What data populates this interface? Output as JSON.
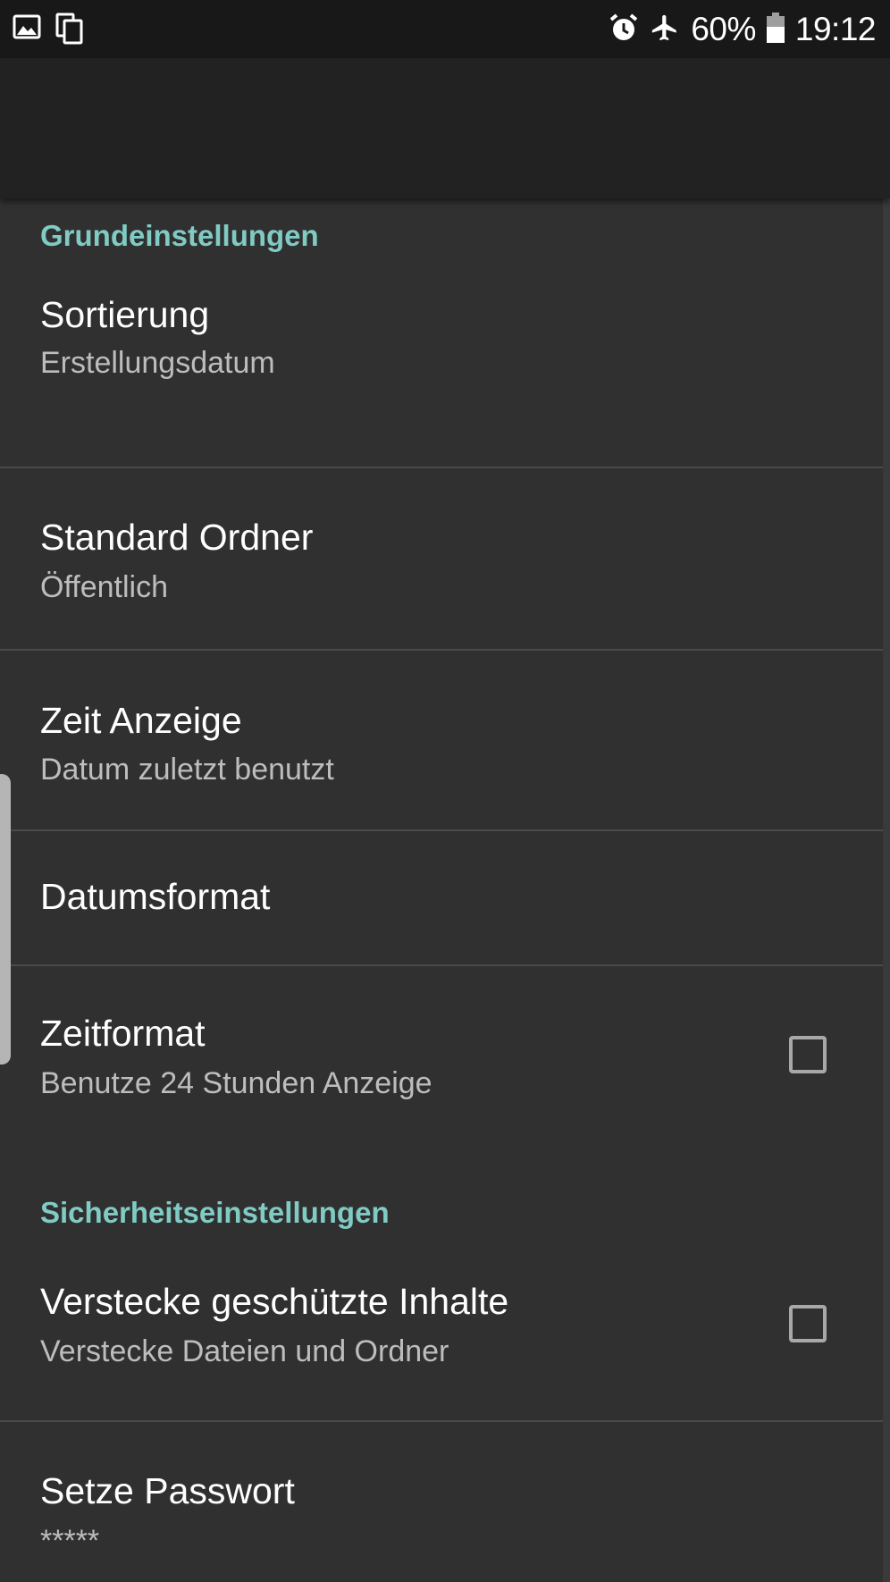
{
  "status_bar": {
    "icons_left": [
      "image-icon",
      "copy-icon"
    ],
    "icons_right": [
      "alarm-icon",
      "airplane-mode-icon",
      "battery-icon"
    ],
    "battery": "60%",
    "time": "19:12"
  },
  "colors": {
    "accent": "#80cbc4",
    "background": "#303030",
    "toolbar": "#222222",
    "status_bar": "#181818"
  },
  "settings": {
    "basic_header": "Grundeinstellungen",
    "sort": {
      "title": "Sortierung",
      "summary": "Erstellungsdatum"
    },
    "default_folder": {
      "title": "Standard Ordner",
      "summary": "Öffentlich"
    },
    "time_display": {
      "title": "Zeit Anzeige",
      "summary": "Datum zuletzt benutzt"
    },
    "date_format": {
      "title": "Datumsformat"
    },
    "time_format": {
      "title": "Zeitformat",
      "summary": "Benutze 24 Stunden Anzeige",
      "checked": false
    },
    "security_header": "Sicherheitseinstellungen",
    "hide_protected": {
      "title": "Verstecke geschützte Inhalte",
      "summary": "Verstecke Dateien und Ordner",
      "checked": false
    },
    "set_password": {
      "title": "Setze Passwort",
      "summary": "*****"
    }
  }
}
